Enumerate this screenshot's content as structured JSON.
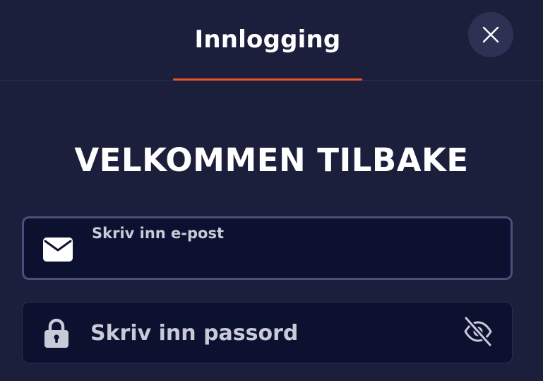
{
  "header": {
    "tab_label": "Innlogging",
    "close_icon": "close-icon"
  },
  "main": {
    "title": "VELKOMMEN TILBAKE"
  },
  "form": {
    "email": {
      "label": "Skriv inn e-post",
      "value": "",
      "icon": "mail-icon"
    },
    "password": {
      "placeholder": "Skriv inn passord",
      "value": "",
      "icon": "lock-icon",
      "toggle_icon": "eye-off-icon"
    }
  },
  "colors": {
    "background": "#1b1f3b",
    "field_background": "#0d1130",
    "accent": "#e8562a",
    "text": "#ffffff",
    "muted_text": "#c8cad8"
  }
}
